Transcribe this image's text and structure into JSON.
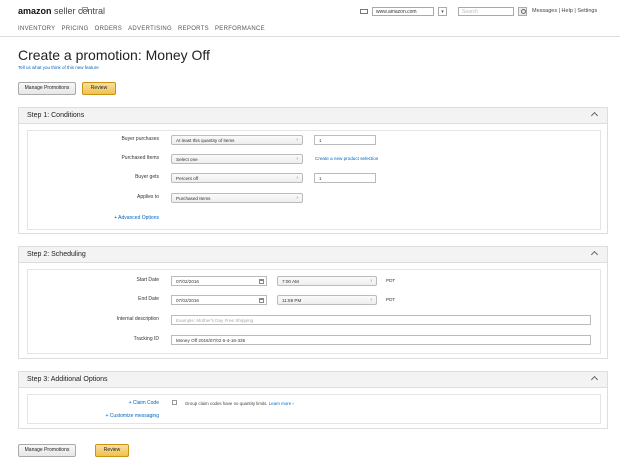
{
  "header": {
    "logo_bold": "amazon",
    "logo_rest": "seller central",
    "marketplace": "www.amazon.com",
    "search_placeholder": "Search",
    "top_links": "Messages | Help | Settings"
  },
  "nav": [
    "INVENTORY",
    "PRICING",
    "ORDERS",
    "ADVERTISING",
    "REPORTS",
    "PERFORMANCE"
  ],
  "page": {
    "title": "Create a promotion: Money Off",
    "feedback": "Tell us what you think of this new feature"
  },
  "actions": {
    "manage": "Manage Promotions",
    "review": "Review"
  },
  "step1": {
    "title": "Step 1: Conditions",
    "buyer_purchases_label": "Buyer purchases",
    "buyer_purchases_value": "At least this quantity of items",
    "buyer_purchases_qty": "1",
    "purchased_items_label": "Purchased Items",
    "purchased_items_value": "Select one",
    "create_selection_link": "Create a new product selection",
    "buyer_gets_label": "Buyer gets",
    "buyer_gets_value": "Percent off",
    "buyer_gets_amount": "1",
    "applies_to_label": "Applies to",
    "applies_to_value": "Purchased Items",
    "advanced_options": "+ Advanced Options"
  },
  "step2": {
    "title": "Step 2: Scheduling",
    "start_label": "Start Date",
    "start_date": "07/02/2016",
    "start_time": "7:00 AM",
    "start_tz": "PDT",
    "end_label": "End Date",
    "end_date": "07/02/2016",
    "end_time": "11:59 PM",
    "end_tz": "PDT",
    "internal_label": "Internal description",
    "internal_placeholder": "Example: Mother's Day Free Shipping",
    "tracking_label": "Tracking ID",
    "tracking_value": "Money Off 2016/07/02 6-4-16-335"
  },
  "step3": {
    "title": "Step 3: Additional Options",
    "claim_code_label": "+ Claim Code",
    "claim_note": "Group claim codes have no quantity limits.",
    "claim_learn": "Learn more",
    "customer_messaging": "+ Customize messaging"
  },
  "colors": {
    "link": "#0066c0",
    "review_button": "#f0c14b",
    "panel_header": "#f3f3f3"
  }
}
